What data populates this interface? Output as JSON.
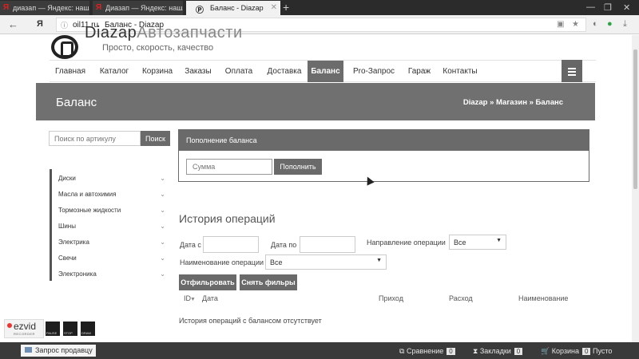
{
  "browser": {
    "tabs": [
      {
        "favicon": "Я",
        "label": "диазап — Яндекс: нашлось"
      },
      {
        "favicon": "Я",
        "label": "Диазап — Яндекс: нашлось"
      },
      {
        "favicon": "Ⓟ",
        "label": "Баланс - Diazap"
      }
    ],
    "new_tab": "+",
    "window_controls": [
      "—",
      "❐",
      "✕"
    ],
    "back": "←",
    "yandex": "Я",
    "url": "oil11.ru",
    "page_title": "Баланс - Diazap"
  },
  "site": {
    "brand_bold": "Diazap",
    "brand_rest": "Автозапчасти",
    "tagline": "Просто, скорость, качество",
    "nav": [
      "Главная",
      "Каталог",
      "Корзина",
      "Заказы",
      "Оплата",
      "Доставка",
      "Баланс",
      "Pro-Запрос",
      "Гараж",
      "Контакты"
    ],
    "nav_active_index": 6,
    "banner_title": "Баланс",
    "breadcrumbs": "Diazap » Магазин » Баланс"
  },
  "search": {
    "placeholder": "Поиск по артикулу",
    "button": "Поиск"
  },
  "sidebar": {
    "categories": [
      "Диски",
      "Масла и автохимия",
      "Тормозные жидкости",
      "Шины",
      "Электрика",
      "Свечи",
      "Электроника"
    ]
  },
  "balance_panel": {
    "header": "Пополнение баланса",
    "amount_placeholder": "Сумма",
    "topup_button": "Пополнить"
  },
  "history": {
    "title": "История операций",
    "date_from_label": "Дата с",
    "date_to_label": "Дата по",
    "direction_label": "Направление операции",
    "direction_value": "Все",
    "operation_name_label": "Наименование операции",
    "operation_name_value": "Все",
    "filter_button": "Отфильровать",
    "reset_button": "Снять фильры",
    "columns": [
      "ID",
      "Дата",
      "Приход",
      "Расход",
      "Наименование"
    ],
    "empty_message": "История операций с балансом отсутствует"
  },
  "recorder": {
    "brand": "ezvid",
    "sub": "RECORDER",
    "controls": [
      "PAUSE",
      "STOP",
      "DRAW"
    ]
  },
  "footer": {
    "ask_seller": "Запрос продавцу",
    "compare_label": "Сравнение",
    "compare_count": "0",
    "bookmarks_label": "Закладки",
    "bookmarks_count": "0",
    "cart_label": "Корзина",
    "cart_count": "0",
    "cart_status": "Пусто"
  },
  "colors": {
    "accent_gray": "#6a6a6a",
    "banner": "#707070",
    "footer": "#3a3a3a"
  }
}
